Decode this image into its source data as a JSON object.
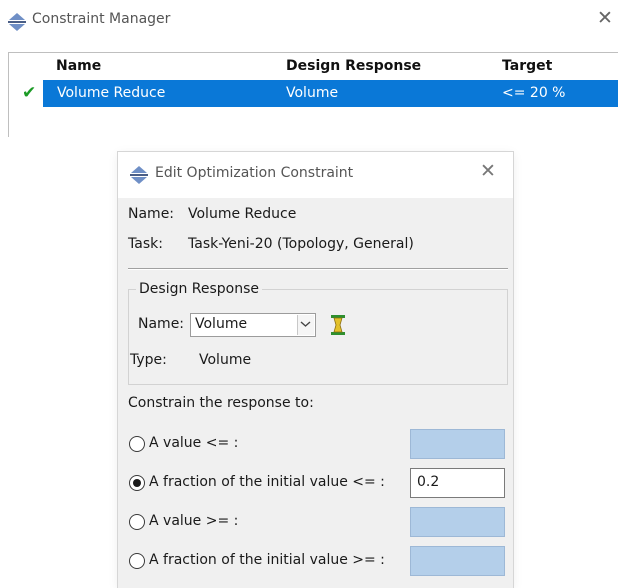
{
  "constraint_manager": {
    "title": "Constraint Manager",
    "close_glyph": "✕",
    "columns": [
      "Name",
      "Design Response",
      "Target"
    ],
    "rows": [
      {
        "status_icon": "checkmark-icon",
        "name": "Volume Reduce",
        "design_response": "Volume",
        "target": "<= 20 %"
      }
    ]
  },
  "dialog": {
    "title": "Edit Optimization Constraint",
    "close_glyph": "✕",
    "name_label": "Name:",
    "name_value": "Volume Reduce",
    "task_label": "Task:",
    "task_value": "Task-Yeni-20 (Topology, General)",
    "design_response": {
      "group_title": "Design Response",
      "name_label": "Name:",
      "name_selected": "Volume",
      "create_icon": "design-response-create-icon",
      "type_label": "Type:",
      "type_value": "Volume"
    },
    "constrain_label": "Constrain the response to:",
    "options": [
      {
        "label": "A value <= :",
        "selected": false,
        "value": ""
      },
      {
        "label": "A fraction of the initial value <= :",
        "selected": true,
        "value": "0.2"
      },
      {
        "label": "A value >= :",
        "selected": false,
        "value": ""
      },
      {
        "label": "A fraction of the initial value >= :",
        "selected": false,
        "value": ""
      }
    ]
  },
  "colors": {
    "selection": "#0a78d7",
    "check": "#1c9b26",
    "disabled_field": "#b4cfea",
    "dialog_body": "#f0f0f0"
  }
}
